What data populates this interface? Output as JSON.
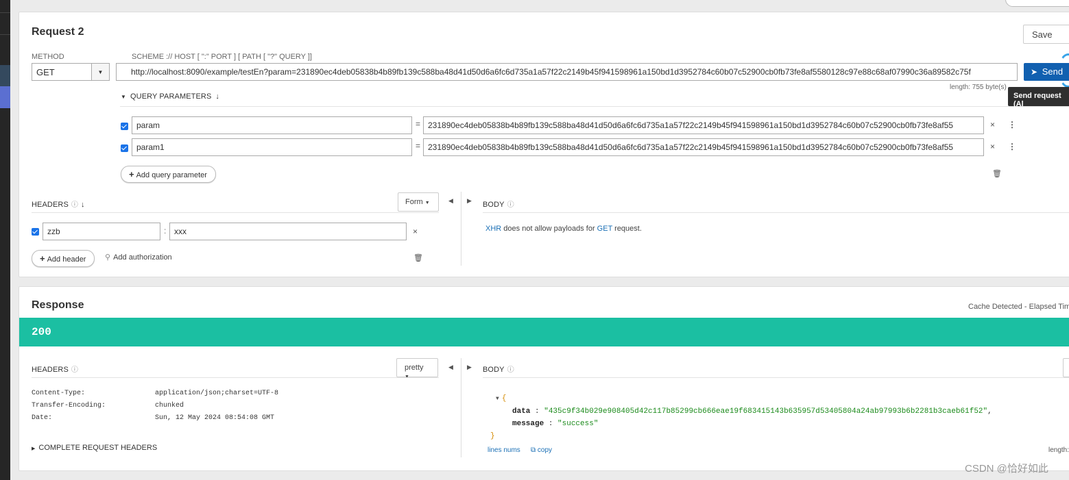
{
  "request": {
    "title": "Request 2",
    "save_label": "Save",
    "method_label": "METHOD",
    "method_value": "GET",
    "url_label": "SCHEME :// HOST [ \":\" PORT ] [ PATH [ \"?\" QUERY ]]",
    "url_value": "http://localhost:8090/example/testEn?param=231890ec4deb05838b4b89fb139c588ba48d41d50d6a6fc6d735a1a57f22c2149b45f941598961a150bd1d3952784c60b07c52900cb0fb73fe8af5580128c97e88c68af07990c36a89582c75f",
    "send_label": "Send",
    "length_text": "length: 755 byte(s)",
    "tooltip": "Send request (Al",
    "query_section": "QUERY PARAMETERS",
    "query_params": [
      {
        "name": "param",
        "value": "231890ec4deb05838b4b89fb139c588ba48d41d50d6a6fc6d735a1a57f22c2149b45f941598961a150bd1d3952784c60b07c52900cb0fb73fe8af55"
      },
      {
        "name": "param1",
        "value": "231890ec4deb05838b4b89fb139c588ba48d41d50d6a6fc6d735a1a57f22c2149b45f941598961a150bd1d3952784c60b07c52900cb0fb73fe8af55"
      }
    ],
    "add_query_label": "Add query parameter",
    "headers_label": "HEADERS",
    "form_label": "Form",
    "headers": [
      {
        "name": "zzb",
        "value": "xxx"
      }
    ],
    "add_header_label": "Add header",
    "add_auth_label": "Add authorization",
    "body_label": "BODY",
    "body_msg": {
      "xhr": "XHR",
      "mid": "does not allow payloads for",
      "method": "GET",
      "end": "request."
    }
  },
  "response": {
    "title": "Response",
    "cache_text": "Cache Detected - Elapsed Tim",
    "status": "200",
    "headers_label": "HEADERS",
    "pretty_label": "pretty",
    "headers": [
      {
        "name": "Content-Type:",
        "value": "application/json;charset=UTF-8"
      },
      {
        "name": "Transfer-Encoding:",
        "value": "chunked"
      },
      {
        "name": "Date:",
        "value": "Sun, 12 May 2024 08:54:08 GMT"
      }
    ],
    "complete_headers_label": "COMPLETE REQUEST HEADERS",
    "body_label": "BODY",
    "json": {
      "data_key": "data",
      "data_value": "\"435c9f34b029e908405d42c117b85299cb666eae19f683415143b635957d53405804a24ab97993b6b2281b3caeb61f52\"",
      "message_key": "message",
      "message_value": "\"success\""
    },
    "lines_nums_label": "lines nums",
    "copy_label": "copy",
    "length_text": "length:"
  },
  "watermark": "CSDN @恰好如此",
  "colors": {
    "status_bar": "#1bbfa2",
    "send_button": "#1160b0",
    "link": "#1a6fb5"
  }
}
